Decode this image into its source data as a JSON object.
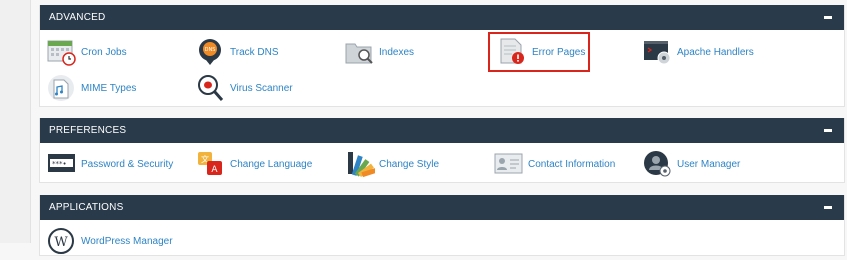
{
  "advanced": {
    "title": "ADVANCED",
    "items": [
      {
        "label": "Cron Jobs",
        "icon": "calendar-clock-icon"
      },
      {
        "label": "Track DNS",
        "icon": "dns-pin-icon"
      },
      {
        "label": "Indexes",
        "icon": "folder-search-icon"
      },
      {
        "label": "Error Pages",
        "icon": "error-document-icon"
      },
      {
        "label": "Apache Handlers",
        "icon": "terminal-gear-icon"
      },
      {
        "label": "MIME Types",
        "icon": "music-document-icon"
      },
      {
        "label": "Virus Scanner",
        "icon": "magnifier-bug-icon"
      }
    ]
  },
  "preferences": {
    "title": "PREFERENCES",
    "items": [
      {
        "label": "Password & Security",
        "icon": "password-field-icon"
      },
      {
        "label": "Change Language",
        "icon": "language-translate-icon"
      },
      {
        "label": "Change Style",
        "icon": "color-swatch-icon"
      },
      {
        "label": "Contact Information",
        "icon": "contact-card-icon"
      },
      {
        "label": "User Manager",
        "icon": "user-gear-icon"
      }
    ]
  },
  "applications": {
    "title": "APPLICATIONS",
    "items": [
      {
        "label": "WordPress Manager",
        "icon": "wordpress-icon"
      }
    ]
  },
  "colors": {
    "header_bg": "#293a4a",
    "link": "#2e84c5",
    "highlight": "#d9261c"
  }
}
